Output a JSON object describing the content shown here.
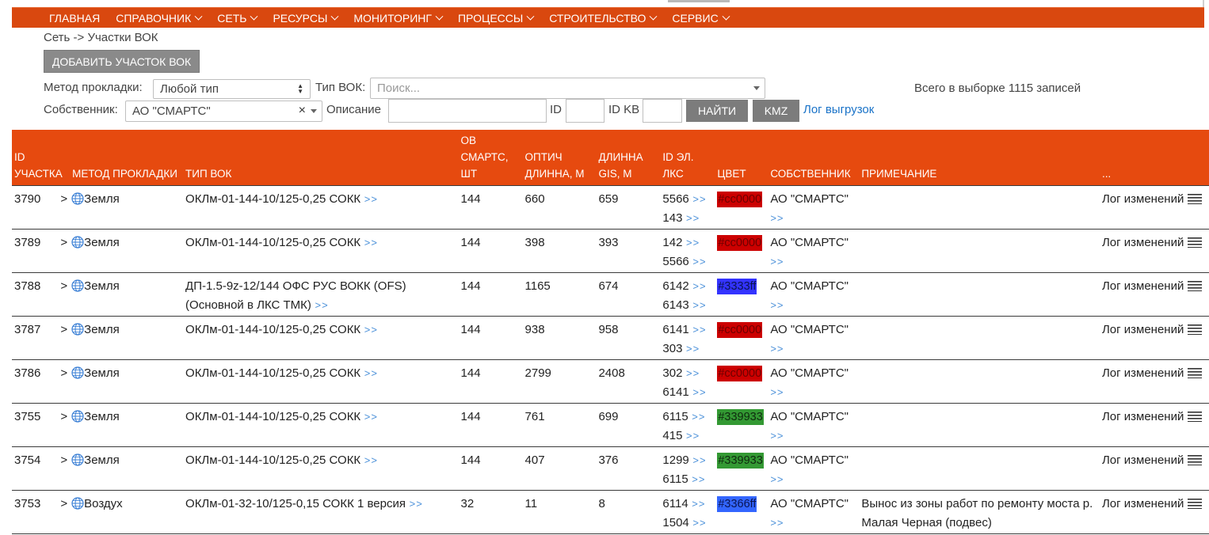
{
  "nav": {
    "items": [
      {
        "label": "ГЛАВНАЯ",
        "dropdown": false
      },
      {
        "label": "СПРАВОЧНИК",
        "dropdown": true
      },
      {
        "label": "СЕТЬ",
        "dropdown": true
      },
      {
        "label": "РЕСУРСЫ",
        "dropdown": true
      },
      {
        "label": "МОНИТОРИНГ",
        "dropdown": true
      },
      {
        "label": "ПРОЦЕССЫ",
        "dropdown": true
      },
      {
        "label": "СТРОИТЕЛЬСТВО",
        "dropdown": true
      },
      {
        "label": "СЕРВИС",
        "dropdown": true
      }
    ]
  },
  "breadcrumb": "Сеть -> Участки ВОК",
  "add_button": "ДОБАВИТЬ УЧАСТОК ВОК",
  "filters": {
    "method_label": "Метод прокладки:",
    "method_value": "Любой тип",
    "type_label": "Тип ВОК:",
    "type_placeholder": "Поиск...",
    "owner_label": "Собственник:",
    "owner_value": "АО \"СМАРТС\"",
    "description_label": "Описание",
    "id_label": "ID",
    "id_kv_label": "ID KB",
    "find_button": "НАЙТИ",
    "kmz_button": "KMZ",
    "log_link": "Лог выгрузок",
    "total": "Всего в выборке 1115 записей"
  },
  "table": {
    "headers": [
      "ID УЧАСТКА",
      "МЕТОД ПРОКЛАДКИ",
      "ТИП ВОК",
      "ОВ СМАРТС, ШТ",
      "ОПТИЧ ДЛИННА, М",
      "ДЛИННА GIS, М",
      "ID ЭЛ. ЛКС",
      "ЦВЕТ",
      "СОБСТВЕННИК",
      "ПРИМЕЧАНИЕ",
      "..."
    ],
    "row_prefix": ">",
    "arrows": ">>",
    "log_label": "Лог изменений",
    "rows": [
      {
        "id": "3790",
        "method": "Земля",
        "type": "ОКЛм-01-144-10/125-0,25 СОКК",
        "type2": "",
        "fibers": "144",
        "optical": "660",
        "gis": "659",
        "lks1": "5566",
        "lks2": "143",
        "color": "#cc0000",
        "color_label": "#cc0000",
        "owner": "АО \"СМАРТС\"",
        "note": ""
      },
      {
        "id": "3789",
        "method": "Земля",
        "type": "ОКЛм-01-144-10/125-0,25 СОКК",
        "type2": "",
        "fibers": "144",
        "optical": "398",
        "gis": "393",
        "lks1": "142",
        "lks2": "5566",
        "color": "#cc0000",
        "color_label": "#cc0000",
        "owner": "АО \"СМАРТС\"",
        "note": ""
      },
      {
        "id": "3788",
        "method": "Земля",
        "type": "ДП-1.5-9z-12/144 ОФС РУС ВОКК (OFS)",
        "type2": "(Основной в ЛКС ТМК)",
        "fibers": "144",
        "optical": "1165",
        "gis": "674",
        "lks1": "6142",
        "lks2": "6143",
        "color": "#3333ff",
        "color_label": "#3333ff",
        "owner": "АО \"СМАРТС\"",
        "note": ""
      },
      {
        "id": "3787",
        "method": "Земля",
        "type": "ОКЛм-01-144-10/125-0,25 СОКК",
        "type2": "",
        "fibers": "144",
        "optical": "938",
        "gis": "958",
        "lks1": "6141",
        "lks2": "303",
        "color": "#cc0000",
        "color_label": "#cc0000",
        "owner": "АО \"СМАРТС\"",
        "note": ""
      },
      {
        "id": "3786",
        "method": "Земля",
        "type": "ОКЛм-01-144-10/125-0,25 СОКК",
        "type2": "",
        "fibers": "144",
        "optical": "2799",
        "gis": "2408",
        "lks1": "302",
        "lks2": "6141",
        "color": "#cc0000",
        "color_label": "#cc0000",
        "owner": "АО \"СМАРТС\"",
        "note": ""
      },
      {
        "id": "3755",
        "method": "Земля",
        "type": "ОКЛм-01-144-10/125-0,25 СОКК",
        "type2": "",
        "fibers": "144",
        "optical": "761",
        "gis": "699",
        "lks1": "6115",
        "lks2": "415",
        "color": "#339933",
        "color_label": "#339933",
        "owner": "АО \"СМАРТС\"",
        "note": ""
      },
      {
        "id": "3754",
        "method": "Земля",
        "type": "ОКЛм-01-144-10/125-0,25 СОКК",
        "type2": "",
        "fibers": "144",
        "optical": "407",
        "gis": "376",
        "lks1": "1299",
        "lks2": "6115",
        "color": "#339933",
        "color_label": "#339933",
        "owner": "АО \"СМАРТС\"",
        "note": ""
      },
      {
        "id": "3753",
        "method": "Воздух",
        "type": "ОКЛм-01-32-10/125-0,15 СОКК 1 версия",
        "type2": "",
        "fibers": "32",
        "optical": "11",
        "gis": "8",
        "lks1": "6114",
        "lks2": "1504",
        "color": "#3366ff",
        "color_label": "#3366ff",
        "owner": "АО \"СМАРТС\"",
        "note": "Вынос из зоны работ по ремонту моста р. Малая Черная (подвес)"
      }
    ]
  }
}
